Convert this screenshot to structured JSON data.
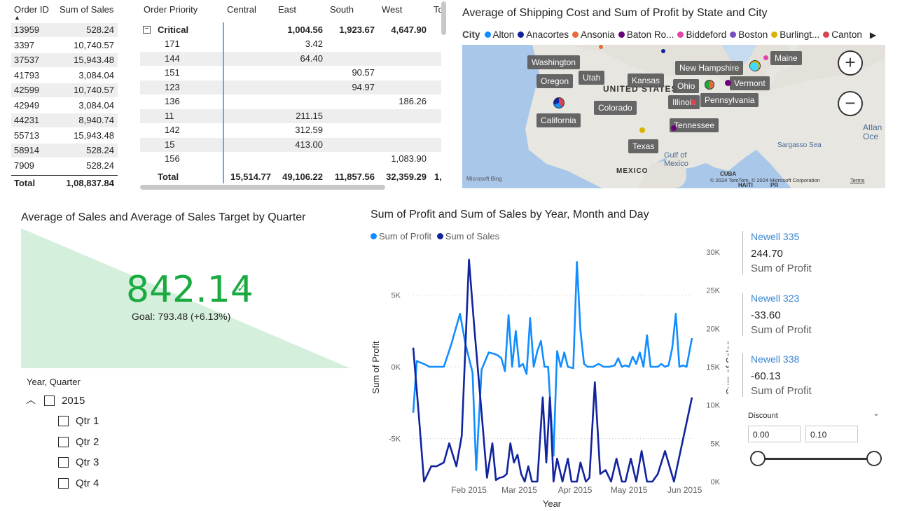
{
  "orders_table": {
    "columns": [
      "Order ID",
      "Sum of Sales"
    ],
    "rows": [
      [
        "13959",
        "528.24"
      ],
      [
        "3397",
        "10,740.57"
      ],
      [
        "37537",
        "15,943.48"
      ],
      [
        "41793",
        "3,084.04"
      ],
      [
        "42599",
        "10,740.57"
      ],
      [
        "42949",
        "3,084.04"
      ],
      [
        "44231",
        "8,940.74"
      ],
      [
        "55713",
        "15,943.48"
      ],
      [
        "58914",
        "528.24"
      ],
      [
        "7909",
        "528.24"
      ]
    ],
    "total_label": "Total",
    "total_value": "1,08,837.84"
  },
  "matrix": {
    "columns": [
      "Order Priority",
      "Central",
      "East",
      "South",
      "West",
      "To"
    ],
    "group_label": "Critical",
    "group_values": [
      "",
      "1,004.56",
      "1,923.67",
      "4,647.90",
      ""
    ],
    "rows": [
      {
        "id": "171",
        "values": [
          "",
          "3.42",
          "",
          "",
          ""
        ]
      },
      {
        "id": "144",
        "values": [
          "",
          "64.40",
          "",
          "",
          ""
        ]
      },
      {
        "id": "151",
        "values": [
          "",
          "",
          "90.57",
          "",
          ""
        ]
      },
      {
        "id": "123",
        "values": [
          "",
          "",
          "94.97",
          "",
          ""
        ]
      },
      {
        "id": "136",
        "values": [
          "",
          "",
          "",
          "186.26",
          ""
        ]
      },
      {
        "id": "11",
        "values": [
          "",
          "211.15",
          "",
          "",
          ""
        ]
      },
      {
        "id": "142",
        "values": [
          "",
          "312.59",
          "",
          "",
          ""
        ]
      },
      {
        "id": "15",
        "values": [
          "",
          "413.00",
          "",
          "",
          ""
        ]
      },
      {
        "id": "156",
        "values": [
          "",
          "",
          "",
          "1,083.90",
          ""
        ]
      }
    ],
    "total_label": "Total",
    "total_values": [
      "15,514.77",
      "49,106.22",
      "11,857.56",
      "32,359.29",
      "1,"
    ]
  },
  "map": {
    "title": "Average of Shipping Cost and Sum of Profit by State and City",
    "legend_label": "City",
    "legend_items": [
      {
        "name": "Alton",
        "color": "#118dff"
      },
      {
        "name": "Anacortes",
        "color": "#12239e"
      },
      {
        "name": "Ansonia",
        "color": "#e66c37"
      },
      {
        "name": "Baton Ro...",
        "color": "#6b007b"
      },
      {
        "name": "Biddeford",
        "color": "#e044a7"
      },
      {
        "name": "Boston",
        "color": "#744ec2"
      },
      {
        "name": "Burlingt...",
        "color": "#d9b300"
      },
      {
        "name": "Canton",
        "color": "#d64550"
      }
    ],
    "state_labels": [
      "Washington",
      "Oregon",
      "Utah",
      "Kansas",
      "Colorado",
      "California",
      "Texas",
      "Illinois",
      "Ohio",
      "Tennessee",
      "Pennsylvania",
      "New Hampshire",
      "Vermont",
      "Maine"
    ],
    "place_labels": {
      "us": "UNITED STATES",
      "mexico": "MEXICO",
      "gulf": "Gulf of Mexico",
      "sargasso": "Sargasso Sea",
      "atlantic": "Atlan Oce",
      "cuba": "CUBA",
      "haiti": "HAITI",
      "pr": "PR"
    },
    "attribution": "© 2024 TomTom, © 2024 Microsoft Corporation",
    "terms": "Terms",
    "bing": "Microsoft Bing"
  },
  "kpi": {
    "title": "Average of Sales and Average of Sales Target by Quarter",
    "value": "842.14",
    "goal": "Goal: 793.48 (+6.13%)",
    "status_color": "#1aab40",
    "check": "✓"
  },
  "slicer": {
    "title": "Year, Quarter",
    "year": "2015",
    "quarters": [
      "Qtr 1",
      "Qtr 2",
      "Qtr 3",
      "Qtr 4"
    ]
  },
  "line_chart": {
    "title": "Sum of Profit and Sum of Sales by Year, Month and Day",
    "x_title": "Year",
    "y_left_title": "Sum of Profit",
    "y_right_title": "Sum of Sales"
  },
  "chart_data": {
    "type": "line",
    "title": "Sum of Profit and Sum of Sales by Year, Month and Day",
    "xlabel": "Year",
    "ylabel": "Sum of Profit",
    "y2label": "Sum of Sales",
    "x_tick_labels": [
      "Feb 2015",
      "Mar 2015",
      "Apr 2015",
      "May 2015",
      "Jun 2015"
    ],
    "y_ticks_left": [
      "-5K",
      "0K",
      "5K"
    ],
    "y_ticks_right": [
      "0K",
      "5K",
      "10K",
      "15K",
      "20K",
      "25K",
      "30K"
    ],
    "ylim": [
      -8000,
      8000
    ],
    "y2lim": [
      0,
      30000
    ],
    "x_day_range": [
      0,
      155
    ],
    "x_tick_days": [
      31,
      59,
      90,
      120,
      151
    ],
    "series": [
      {
        "name": "Sum of Profit",
        "axis": "left",
        "color": "#118dff",
        "values": [
          -3200,
          400,
          200,
          0,
          0,
          0,
          1500,
          3700,
          1600,
          -400,
          -7200,
          -200,
          1000,
          900,
          800,
          600,
          -300,
          3600,
          0,
          2500,
          0,
          200,
          -500,
          3400,
          0,
          1100,
          1800,
          0,
          0,
          -6200,
          1100,
          0,
          1000,
          0,
          -100,
          7300,
          2500,
          200,
          0,
          0,
          200,
          0,
          0,
          100,
          600,
          0,
          100,
          0,
          700,
          200,
          1000,
          0,
          2200,
          0,
          0,
          0,
          200,
          0,
          100,
          1300,
          3700,
          0,
          100,
          0,
          2000
        ],
        "days": [
          0,
          2,
          6,
          9,
          13,
          17,
          21,
          26,
          29,
          33,
          35,
          38,
          42,
          45,
          47,
          49,
          51,
          53,
          55,
          57,
          59,
          61,
          63,
          65,
          67,
          69,
          71,
          73,
          75,
          78,
          80,
          82,
          84,
          86,
          89,
          91,
          93,
          95,
          97,
          100,
          103,
          106,
          109,
          112,
          114,
          116,
          118,
          120,
          122,
          124,
          126,
          128,
          130,
          132,
          134,
          136,
          138,
          140,
          142,
          144,
          146,
          148,
          150,
          152,
          155
        ]
      },
      {
        "name": "Sum of Sales",
        "axis": "right",
        "color": "#12239e",
        "values": [
          17500,
          9000,
          0,
          2000,
          2000,
          2500,
          5000,
          2000,
          6000,
          29000,
          20000,
          9000,
          500,
          5000,
          200,
          500,
          600,
          1000,
          5000,
          2500,
          3500,
          1000,
          0,
          2000,
          0,
          0,
          11000,
          2500,
          11000,
          0,
          3000,
          0,
          3000,
          0,
          0,
          2500,
          0,
          500,
          13000,
          1000,
          1500,
          0,
          3000,
          0,
          0,
          3000,
          0,
          4000,
          0,
          0,
          1000,
          4000,
          0,
          11000
        ],
        "days": [
          0,
          3,
          6,
          10,
          13,
          17,
          20,
          24,
          27,
          31,
          34,
          38,
          41,
          44,
          46,
          48,
          50,
          52,
          54,
          56,
          58,
          60,
          62,
          64,
          66,
          69,
          72,
          74,
          76,
          78,
          80,
          83,
          86,
          88,
          91,
          93,
          96,
          98,
          101,
          104,
          107,
          110,
          113,
          116,
          118,
          121,
          124,
          127,
          130,
          133,
          136,
          140,
          145,
          155
        ]
      }
    ]
  },
  "cards": [
    {
      "name": "Newell 335",
      "value": "244.70",
      "label": "Sum of Profit"
    },
    {
      "name": "Newell 323",
      "value": "-33.60",
      "label": "Sum of Profit"
    },
    {
      "name": "Newell 338",
      "value": "-60.13",
      "label": "Sum of Profit"
    }
  ],
  "discount": {
    "title": "Discount",
    "min": "0.00",
    "max": "0.10"
  }
}
